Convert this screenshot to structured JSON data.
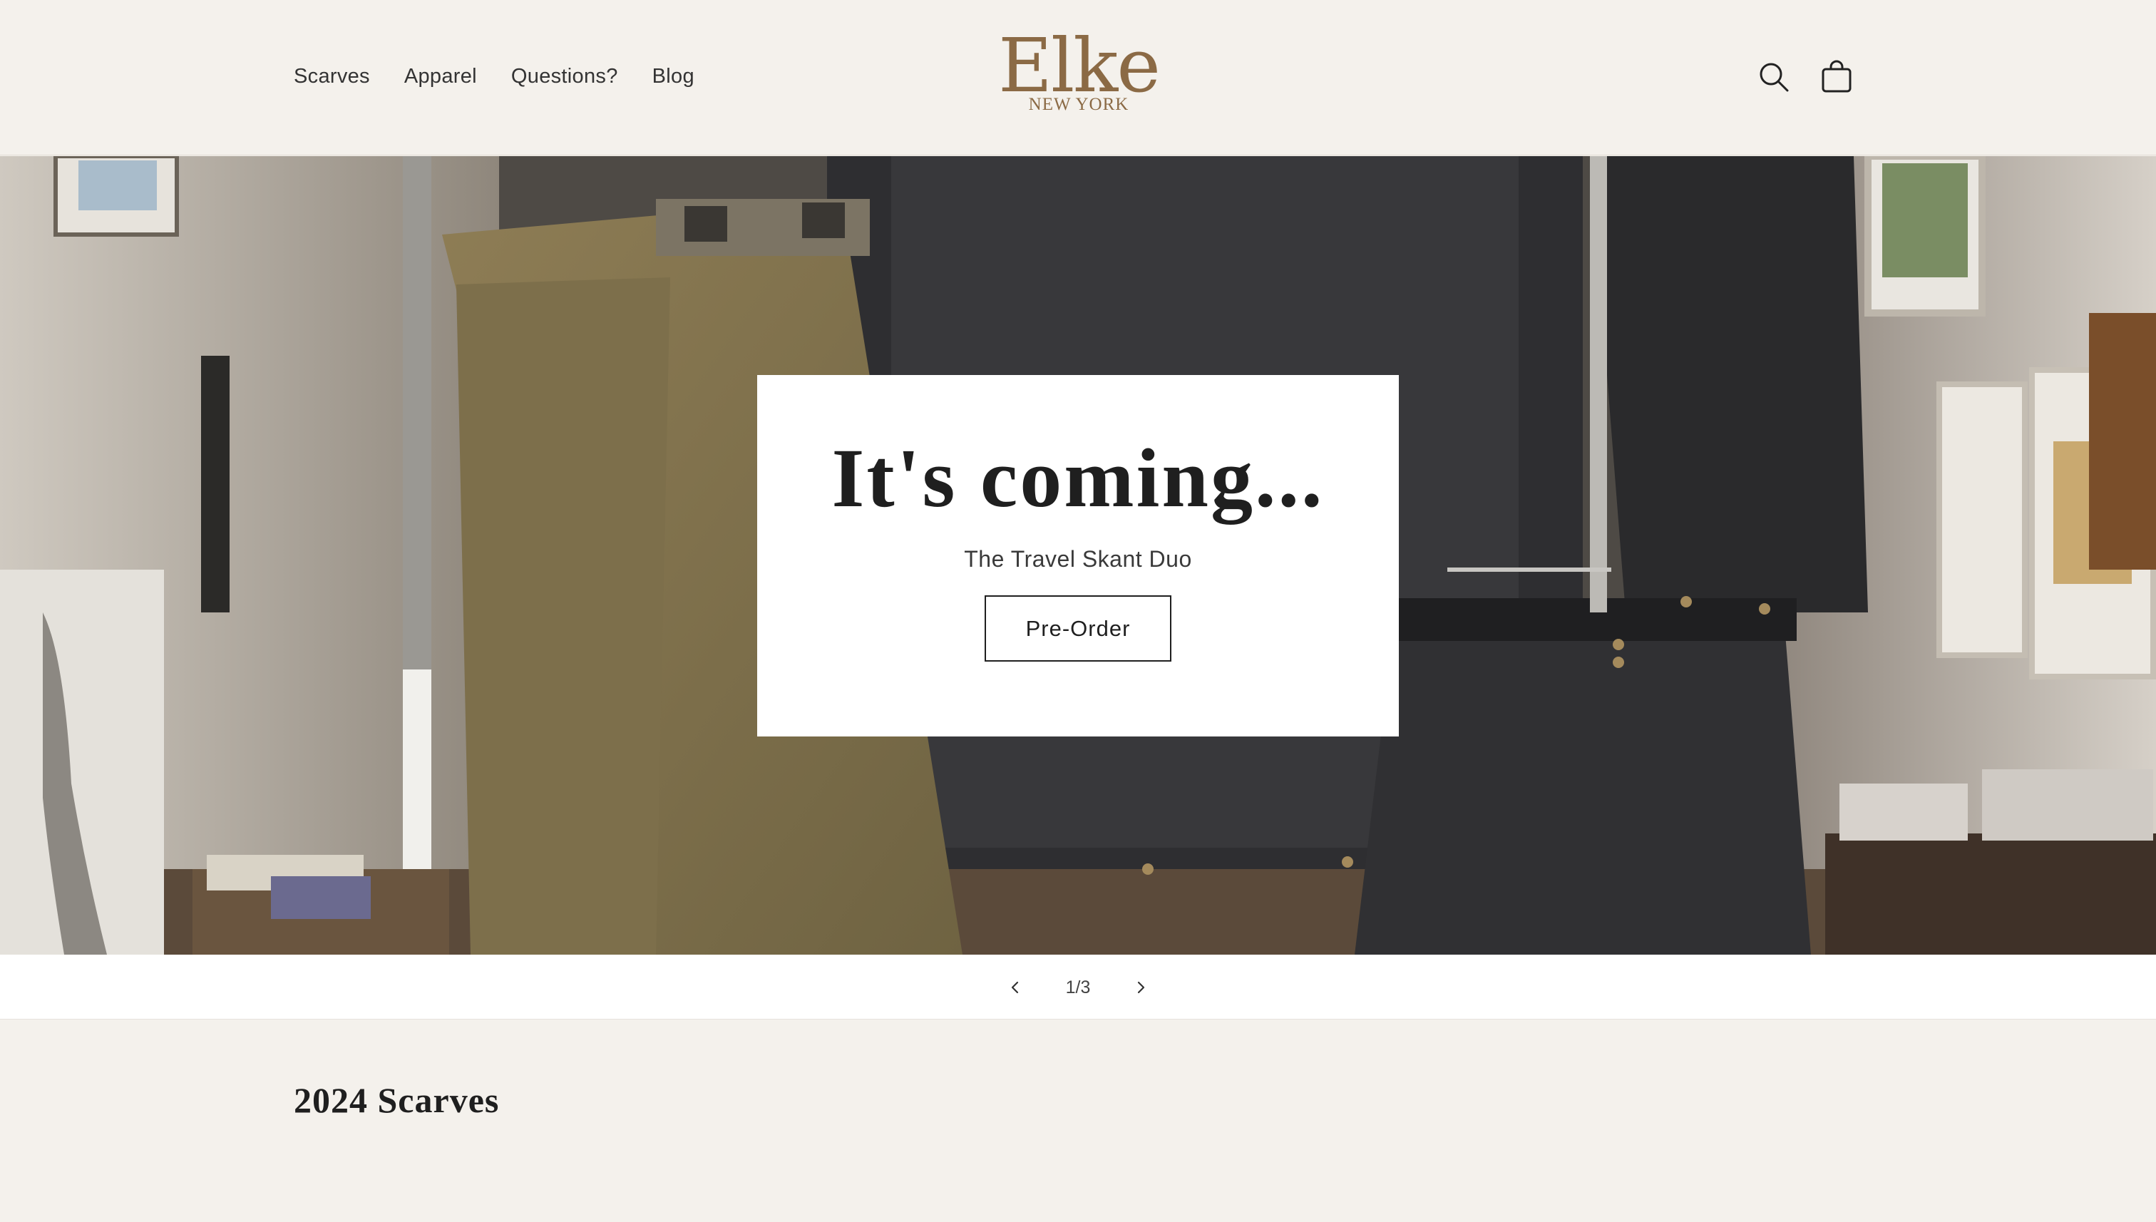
{
  "header": {
    "nav": [
      "Scarves",
      "Apparel",
      "Questions?",
      "Blog"
    ],
    "logo_main": "Elke",
    "logo_sub": "NEW YORK",
    "search_icon": "search-icon",
    "cart_icon": "cart-icon",
    "logo_color": "#8b6a45"
  },
  "hero": {
    "title": "It's coming...",
    "subtitle": "The Travel Skant Duo",
    "button_label": "Pre-Order"
  },
  "slider": {
    "counter": "1/3",
    "prev_icon": "chevron-left-icon",
    "next_icon": "chevron-right-icon"
  },
  "collection": {
    "title": "2024 Scarves"
  },
  "colors": {
    "background": "#f4f1ec",
    "card": "#ffffff",
    "text": "#1f1f1f"
  }
}
